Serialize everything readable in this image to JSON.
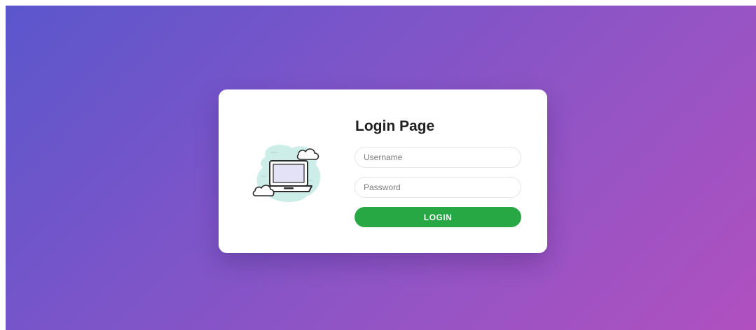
{
  "login": {
    "title": "Login Page",
    "username_placeholder": "Username",
    "password_placeholder": "Password",
    "button_label": "LOGIN"
  },
  "illustration": {
    "icon": "laptop-with-clouds-icon"
  },
  "colors": {
    "gradient_start": "#5b56cc",
    "gradient_end": "#b050c0",
    "card_background": "#ffffff",
    "button": "#28a745",
    "button_text": "#ffffff"
  }
}
